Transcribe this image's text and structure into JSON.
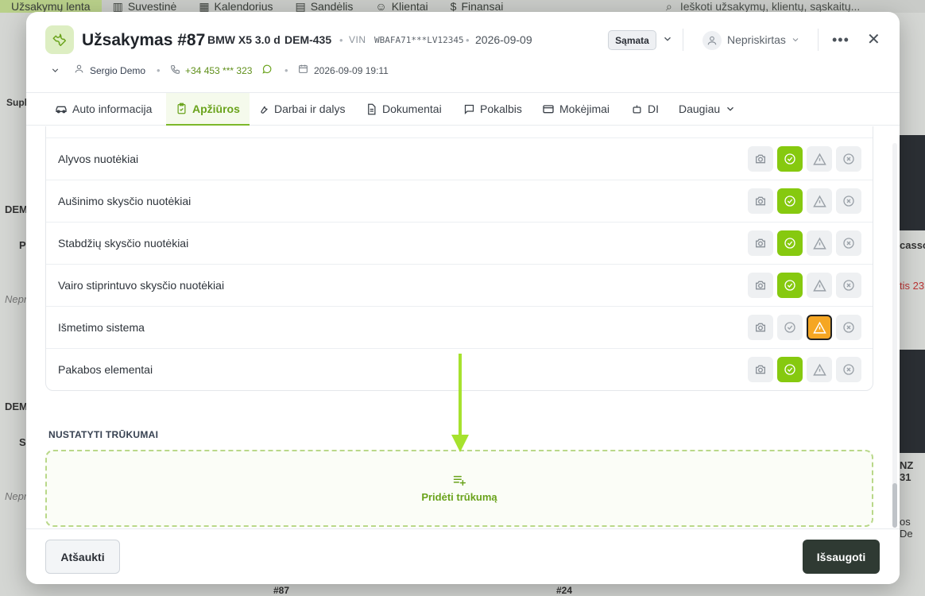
{
  "background": {
    "nav": [
      {
        "label": "Užsakymų lenta",
        "active": true
      },
      {
        "label": "Suvestinė",
        "icon": "chart-icon"
      },
      {
        "label": "Kalendorius",
        "icon": "calendar-icon"
      },
      {
        "label": "Sandėlis",
        "icon": "box-icon"
      },
      {
        "label": "Klientai",
        "icon": "users-icon"
      },
      {
        "label": "Finansai",
        "icon": "dollar-doc-icon"
      }
    ],
    "search_placeholder": "Ieškoti užsakymų, klientų, sąskaitų...",
    "left_labels": [
      "Supl",
      "DEM",
      "P",
      "Nepr",
      "DEM",
      "S",
      "Nepr"
    ],
    "right_labels": [
      "casso",
      "tis 23",
      "NZ 31",
      "os De"
    ],
    "bottom_tags": [
      "#87",
      "#24"
    ]
  },
  "modal": {
    "title": "Užsakymas #87",
    "car": "BMW X5 3.0 d",
    "plate": "DEM-435",
    "vin_label": "VIN",
    "vin": "WBAFA71***LV12345",
    "date": "2026-09-09",
    "estimate_button": "Sąmata",
    "assignee": "Nepriskirtas",
    "meta": {
      "client": "Sergio Demo",
      "phone": "+34 453 *** 323",
      "datetime": "2026-09-09 19:11"
    },
    "tabs": [
      {
        "label": "Auto informacija",
        "icon": "car-icon"
      },
      {
        "label": "Apžiūros",
        "icon": "clipboard-check-icon",
        "active": true
      },
      {
        "label": "Darbai ir dalys",
        "icon": "wrench-icon"
      },
      {
        "label": "Dokumentai",
        "icon": "document-icon"
      },
      {
        "label": "Pokalbis",
        "icon": "chat-icon"
      },
      {
        "label": "Mokėjimai",
        "icon": "card-icon"
      },
      {
        "label": "DI",
        "icon": "robot-icon"
      },
      {
        "label": "Daugiau",
        "icon": "chevron-down-icon"
      }
    ],
    "checks": [
      {
        "label": "Alyvos nuotėkiai",
        "status": "ok"
      },
      {
        "label": "Aušinimo skysčio nuotėkiai",
        "status": "ok"
      },
      {
        "label": "Stabdžių skysčio nuotėkiai",
        "status": "ok"
      },
      {
        "label": "Vairo stiprintuvo skysčio nuotėkiai",
        "status": "ok"
      },
      {
        "label": "Išmetimo sistema",
        "status": "warning"
      },
      {
        "label": "Pakabos elementai",
        "status": "ok"
      }
    ],
    "defects_section_title": "NUSTATYTI TRŪKUMAI",
    "add_defect_label": "Pridėti trūkumą",
    "cancel_label": "Atšaukti",
    "save_label": "Išsaugoti"
  },
  "colors": {
    "accent": "#7cb82a",
    "ok": "#86c90f",
    "warning": "#f5a623",
    "save_button": "#2f3a33",
    "arrow": "#a6e22e"
  }
}
